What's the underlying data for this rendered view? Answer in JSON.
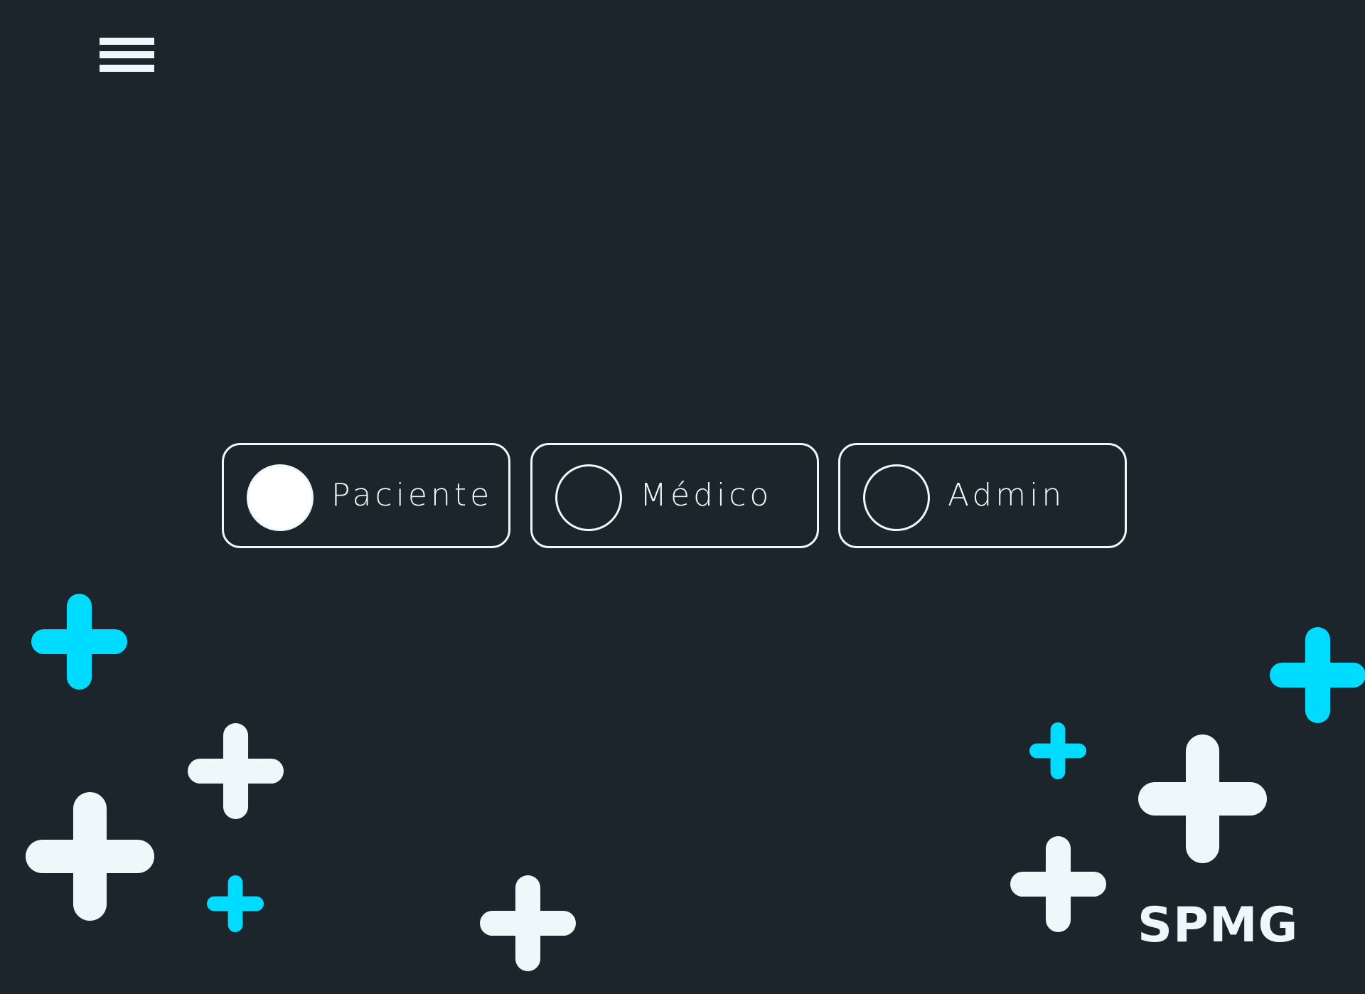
{
  "header": {
    "menu_icon": "hamburger-icon"
  },
  "role_selector": {
    "options": [
      {
        "label": "Paciente",
        "selected": true
      },
      {
        "label": "Médico",
        "selected": false
      },
      {
        "label": "Admin",
        "selected": false
      }
    ]
  },
  "brand": {
    "logo": "SPMG"
  },
  "colors": {
    "background": "#1c252c",
    "foreground": "#eef7fa",
    "accent": "#00dcff"
  }
}
